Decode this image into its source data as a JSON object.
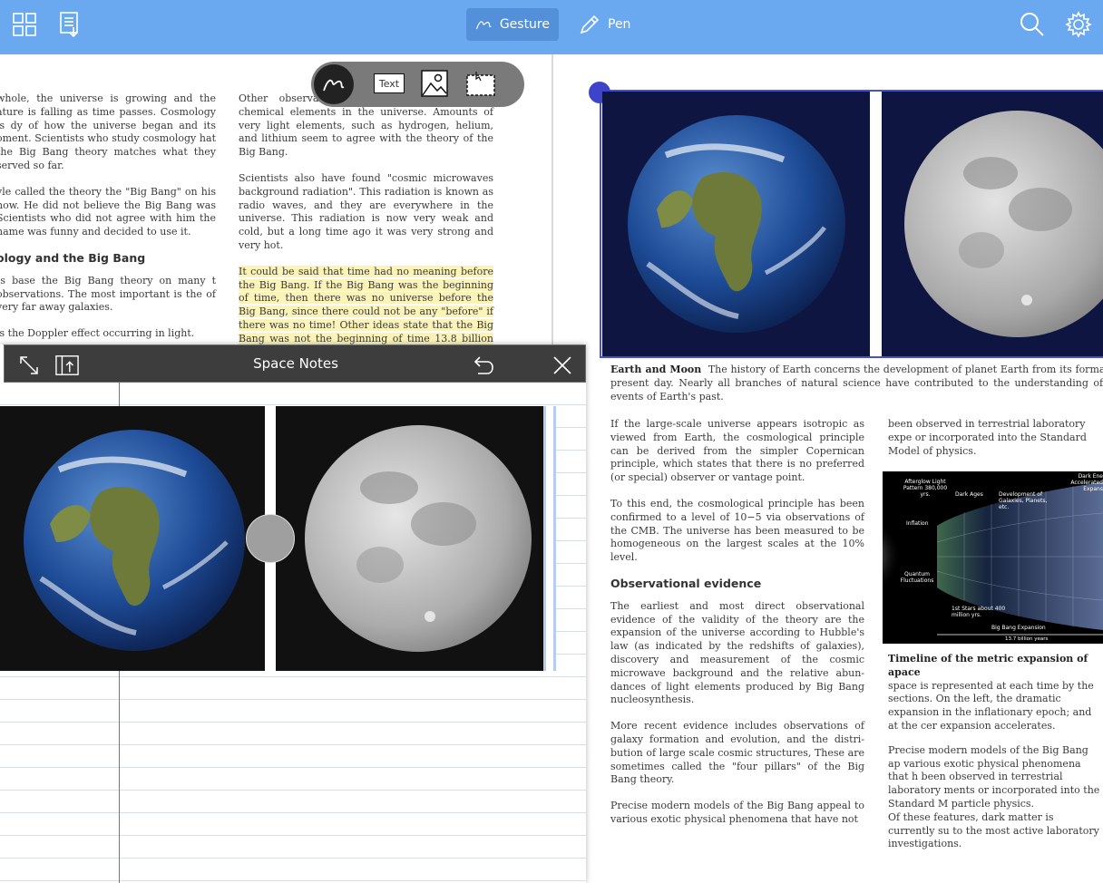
{
  "toolbar": {
    "grid_icon": "grid-icon",
    "export_icon": "export-icon",
    "gesture_label": "Gesture",
    "pen_label": "Pen",
    "search_icon": "search-icon",
    "settings_icon": "gear-icon",
    "accent": "#6aa9ef"
  },
  "float_tools": {
    "text_label": "Text"
  },
  "left_page": {
    "col1": {
      "p1": "whole, the universe is growing and the ature is falling as time passes. Cosmology is dy of how the universe began and its oment. Scientists who study cosmology hat the Big Bang theory matches what they served so far.",
      "p2": "yle called the theory the \"Big Bang\" on his how. He did not believe the Big Bang was Scientists who did not agree with him the name was funny and decided to use it.",
      "heading": "ology and the Big Bang",
      "p3": "ts base the Big Bang theory on many t observations. The most important is the of very far away galaxies.",
      "p4": "is the Doppler effect occurring in light."
    },
    "col2": {
      "p1": "Other observa theory are the amounts of chemical elements in the universe. Amounts of very light elements, such as hydrogen, helium, and lithium seem to agree with the theory of the Big Bang.",
      "p2": "Scientists also have found \"cosmic microwaves background radiation\". This radiation is known as radio waves, and they are everywhere in the universe. This radiation is now very weak and cold, but a long time ago it was very strong and very hot.",
      "p3": "It could be said that time had no meaning before the Big Bang. If the Big Bang was the beginning of time, then there was no universe before the Big Bang, since there could not be any \"before\" if there was no time! Other ideas state that the Big Bang was not the beginning of time 13.8 billion years ago."
    }
  },
  "notes_panel": {
    "title": "Space Notes"
  },
  "right_page": {
    "caption_bold": "Earth and Moon",
    "caption_text": "The history of Earth concerns the development of planet Earth from its formatio present day. Nearly all branches of natural science have contributed to the understanding of th events of Earth's past.",
    "col1": {
      "p1": "If the large-scale universe appears isotropic as viewed from Earth, the cosmological principle can be derived from the simpler Copernican principle, which states that there is no preferred (or special) observer or vantage point.",
      "p2": "To this end, the cosmological principle has been confirmed to a level of 10−5 via observations of the CMB. The universe has been measured to be homogeneous on the largest scales at the 10% level.",
      "heading": "Observational evidence",
      "p3": "The earliest and most direct observational evidence of the validity of the theory are the expansion of the universe according to Hubble's law (as indicated by the redshifts of galaxies), discovery and measurement of the cosmic microwave background and the relative abun-dances of light elements produced by Big Bang nucleosynthesis.",
      "p4": "More recent evidence includes observations of galaxy formation and evolution, and the distri-bution of large scale cosmic structures, These are sometimes called the \"four pillars\" of the Big Bang theory.",
      "p5": "Precise modern models of the Big Bang appeal to various exotic physical phenomena that have not"
    },
    "col2": {
      "p1": "been observed in terrestrial laboratory expe or incorporated into the Standard Model of physics.",
      "diagram": {
        "afterglow": "Afterglow Light Pattern 380,000 yrs.",
        "dark_ages": "Dark Ages",
        "development": "Development of Galaxies, Planets, etc.",
        "dark_energy": "Dark Ene Accelerated Expans",
        "inflation": "Inflation",
        "quantum": "Quantum Fluctuations",
        "first_stars": "1st Stars about 400 million yrs.",
        "expansion": "Big Bang Expansion",
        "years": "13.7 billion years"
      },
      "fig_title": "Timeline of the metric expansion of apace",
      "fig_text": "space is represented at each time by the sections. On the left, the dramatic expansion in the inflationary epoch; and at the cer expansion accelerates.",
      "p2": "Precise modern models of the Big Bang ap various exotic physical phenomena that h been observed in terrestrial laboratory ments or incorporated into the Standard M particle physics.",
      "p3": "Of these features, dark matter is currently su to the most active laboratory investigations."
    }
  }
}
